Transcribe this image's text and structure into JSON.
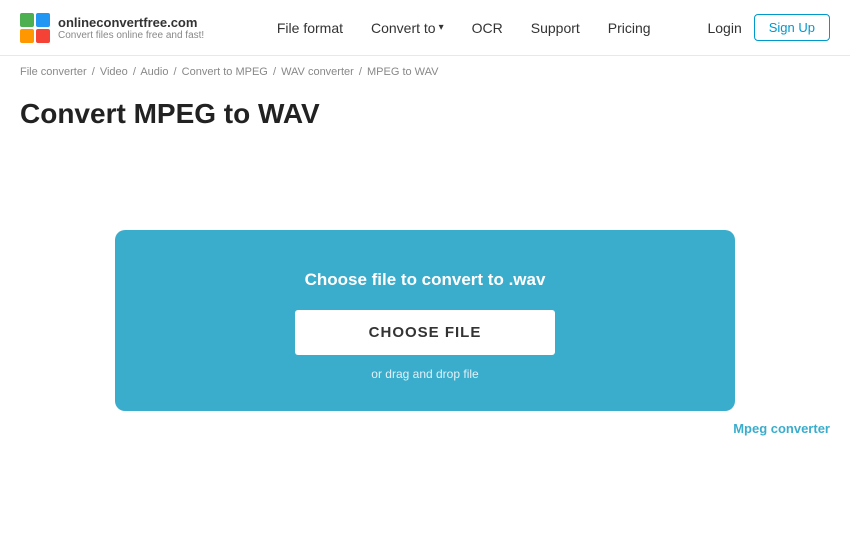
{
  "header": {
    "logo": {
      "name": "onlineconvertfree.com",
      "tagline": "Convert files online free and fast!"
    },
    "nav": [
      {
        "label": "File format",
        "id": "file-format",
        "hasDropdown": false
      },
      {
        "label": "Convert to",
        "id": "convert-to",
        "hasDropdown": true
      },
      {
        "label": "OCR",
        "id": "ocr",
        "hasDropdown": false
      },
      {
        "label": "Support",
        "id": "support",
        "hasDropdown": false
      },
      {
        "label": "Pricing",
        "id": "pricing",
        "hasDropdown": false
      }
    ],
    "login_label": "Login",
    "signup_label": "Sign Up"
  },
  "breadcrumb": {
    "items": [
      {
        "label": "File converter",
        "href": "#"
      },
      {
        "label": "Video",
        "href": "#"
      },
      {
        "label": "Audio",
        "href": "#"
      },
      {
        "label": "Convert to MPEG",
        "href": "#"
      },
      {
        "label": "WAV converter",
        "href": "#"
      },
      {
        "label": "MPEG to WAV",
        "href": "#"
      }
    ]
  },
  "page": {
    "title": "Convert MPEG to WAV"
  },
  "upload": {
    "title": "Choose file to convert to .wav",
    "button_label": "CHOOSE FILE",
    "drag_drop_text": "or drag and drop file"
  },
  "sidebar": {
    "mpeg_converter_label": "Mpeg converter"
  }
}
